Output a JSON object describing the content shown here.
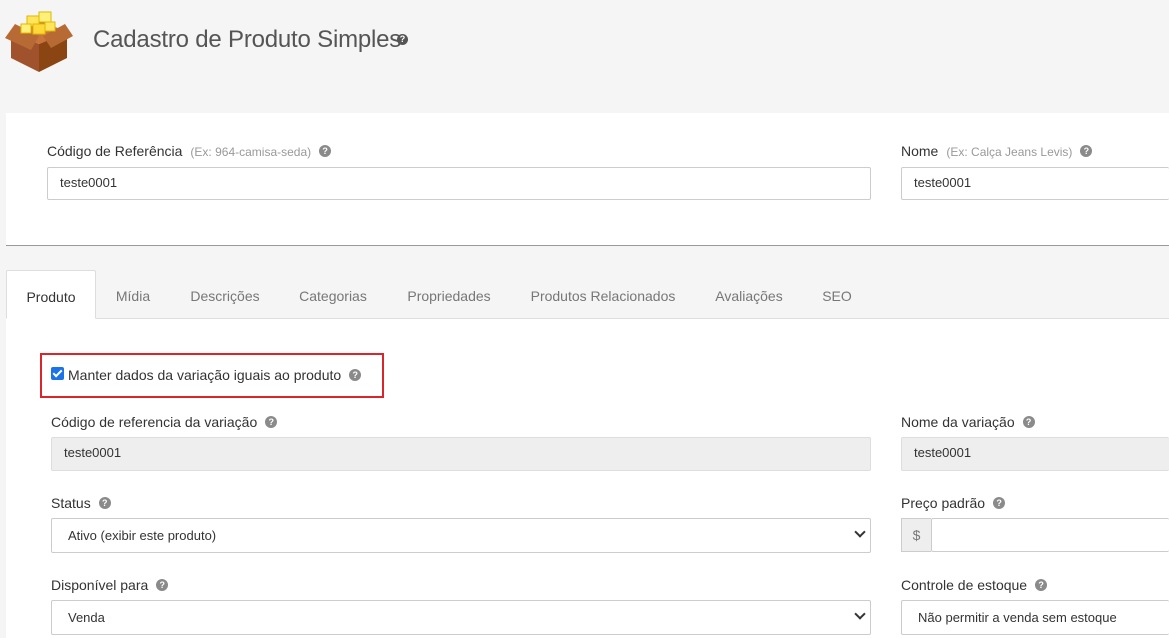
{
  "header": {
    "title": "Cadastro de Produto Simples",
    "logo_icon": "product-box-icon",
    "help_icon": "question-circle-icon"
  },
  "top_form": {
    "ref_code": {
      "label": "Código de Referência",
      "hint": "(Ex: 964-camisa-seda)",
      "value": "teste0001"
    },
    "name": {
      "label": "Nome",
      "hint": "(Ex: Calça Jeans Levis)",
      "value": "teste0001"
    }
  },
  "tabs": [
    {
      "label": "Produto",
      "active": true
    },
    {
      "label": "Mídia"
    },
    {
      "label": "Descrições"
    },
    {
      "label": "Categorias"
    },
    {
      "label": "Propriedades"
    },
    {
      "label": "Produtos Relacionados"
    },
    {
      "label": "Avaliações"
    },
    {
      "label": "SEO"
    }
  ],
  "product_tab": {
    "keep_variation": {
      "label": "Manter dados da variação iguais ao produto",
      "checked": true
    },
    "variation_ref": {
      "label": "Código de referencia da variação",
      "value": "teste0001"
    },
    "variation_name": {
      "label": "Nome da variação",
      "value": "teste0001"
    },
    "status": {
      "label": "Status",
      "value": "Ativo (exibir este produto)"
    },
    "price": {
      "label": "Preço padrão",
      "currency": "$",
      "value": ""
    },
    "available_for": {
      "label": "Disponível para",
      "value": "Venda"
    },
    "stock_control": {
      "label": "Controle de estoque",
      "value": "Não permitir a venda sem estoque"
    }
  },
  "colors": {
    "accent": "#1a73e8",
    "highlight_border": "#d9262c"
  }
}
